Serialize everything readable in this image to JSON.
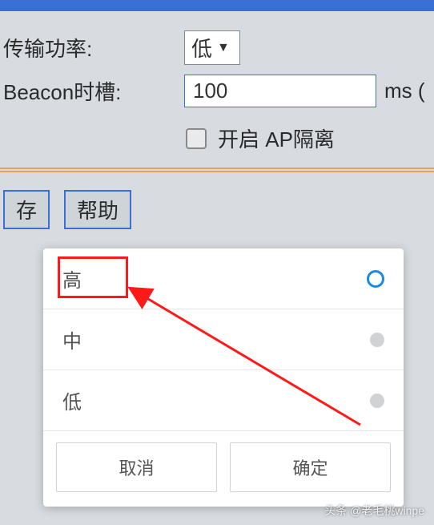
{
  "form": {
    "tx_power_label": "传输功率:",
    "tx_power_value": "低",
    "beacon_label": "Beacon时槽:",
    "beacon_value": "100",
    "beacon_unit": "ms (",
    "ap_isolation_label": "开启 AP隔离"
  },
  "buttons": {
    "save": "存",
    "help": "帮助"
  },
  "popup": {
    "options": [
      {
        "label": "高",
        "selected": true
      },
      {
        "label": "中",
        "selected": false
      },
      {
        "label": "低",
        "selected": false
      }
    ],
    "cancel": "取消",
    "confirm": "确定"
  },
  "watermark": "头条 @老毛桃winpe"
}
